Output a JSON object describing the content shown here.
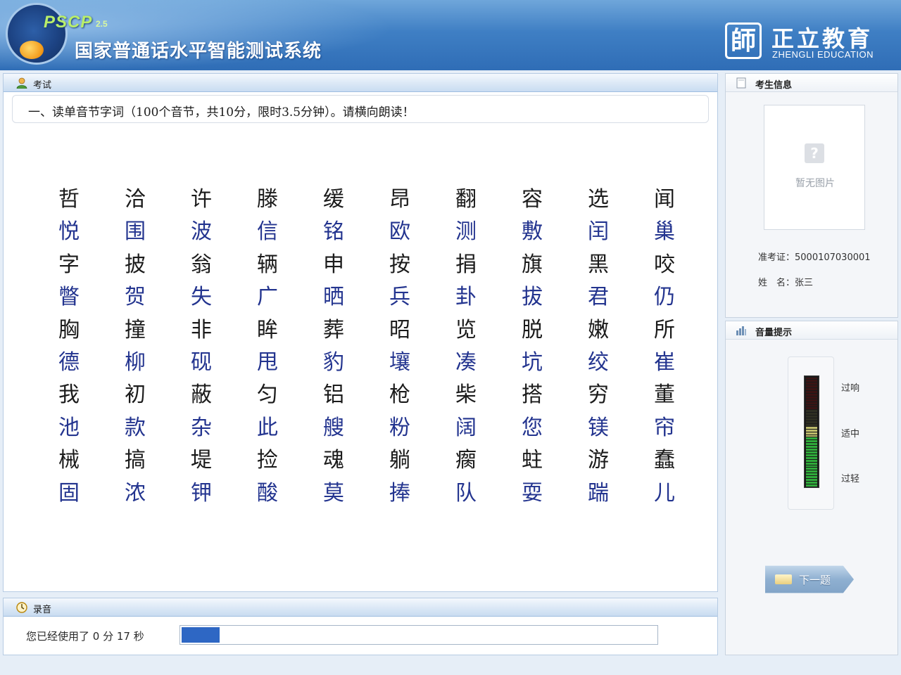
{
  "header": {
    "logo_text": "PSCP",
    "logo_version": "2.5",
    "app_title": "国家普通话水平智能测试系统",
    "brand_mark": "師",
    "brand_cn": "正立教育",
    "brand_en": "ZHENGLI EDUCATION"
  },
  "exam": {
    "panel_title": "考试",
    "instruction": "一、读单音节字词（100个音节，共10分，限时3.5分钟）。请横向朗读！",
    "rows": [
      [
        "哲",
        "洽",
        "许",
        "滕",
        "缓",
        "昂",
        "翻",
        "容",
        "选",
        "闻"
      ],
      [
        "悦",
        "围",
        "波",
        "信",
        "铭",
        "欧",
        "测",
        "敷",
        "闰",
        "巢"
      ],
      [
        "字",
        "披",
        "翁",
        "辆",
        "申",
        "按",
        "捐",
        "旗",
        "黑",
        "咬"
      ],
      [
        "瞥",
        "贺",
        "失",
        "广",
        "晒",
        "兵",
        "卦",
        "拔",
        "君",
        "仍"
      ],
      [
        "胸",
        "撞",
        "非",
        "眸",
        "葬",
        "昭",
        "览",
        "脱",
        "嫩",
        "所"
      ],
      [
        "德",
        "柳",
        "砚",
        "甩",
        "豹",
        "壤",
        "凑",
        "坑",
        "绞",
        "崔"
      ],
      [
        "我",
        "初",
        "蔽",
        "匀",
        "铝",
        "枪",
        "柴",
        "搭",
        "穷",
        "董"
      ],
      [
        "池",
        "款",
        "杂",
        "此",
        "艘",
        "粉",
        "阔",
        "您",
        "镁",
        "帘"
      ],
      [
        "械",
        "搞",
        "堤",
        "捡",
        "魂",
        "躺",
        "瘸",
        "蛀",
        "游",
        "蠢"
      ],
      [
        "固",
        "浓",
        "钾",
        "酸",
        "莫",
        "捧",
        "队",
        "耍",
        "踹",
        "儿"
      ]
    ]
  },
  "record": {
    "panel_title": "录音",
    "elapsed_text": "您已经使用了 0  分 17 秒",
    "progress_fraction": 0.08
  },
  "candidate": {
    "panel_title": "考生信息",
    "photo_placeholder": "暂无图片",
    "admission_label": "准考证：",
    "admission_no": "5000107030001",
    "name_label": "姓　名：",
    "name": "张三"
  },
  "volume": {
    "panel_title": "音量提示",
    "level_fraction": 0.55,
    "labels": {
      "loud": "过响",
      "ok": "适中",
      "quiet": "过轻"
    },
    "next_button": "下一题"
  }
}
